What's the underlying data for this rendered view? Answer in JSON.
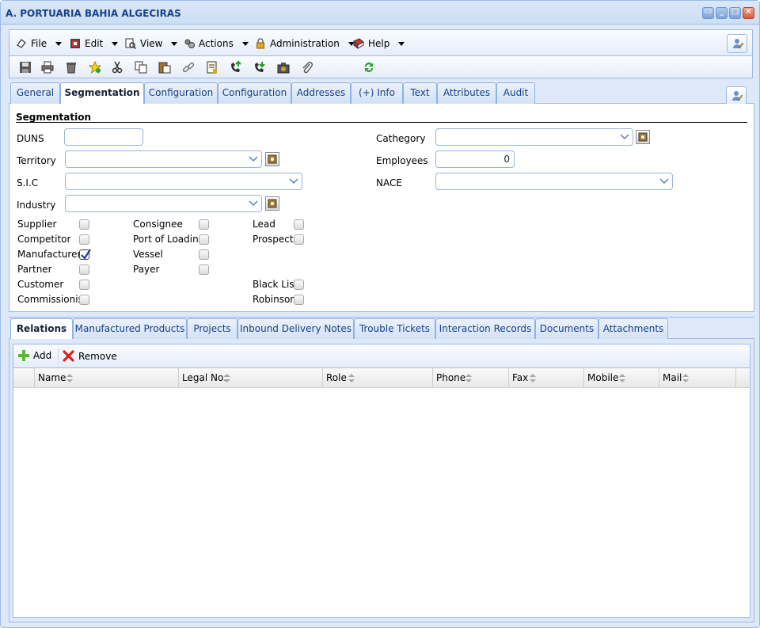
{
  "window": {
    "title": "A. PORTUARIA BAHIA ALGECIRAS",
    "controls": {
      "restore": "▭",
      "minimize": "_",
      "maximize": "□",
      "close": "×"
    }
  },
  "menubar": {
    "items": [
      {
        "label": "File",
        "icon": "file-icon"
      },
      {
        "label": "Edit",
        "icon": "edit-icon"
      },
      {
        "label": "View",
        "icon": "view-icon"
      },
      {
        "label": "Actions",
        "icon": "actions-icon"
      },
      {
        "label": "Administration",
        "icon": "lock-icon"
      },
      {
        "label": "Help",
        "icon": "help-icon"
      }
    ]
  },
  "toolbar": {
    "icons": [
      "save-icon",
      "print-icon",
      "delete-icon",
      "favorite-icon",
      "cut-icon",
      "copy-icon",
      "paste-icon",
      "link-icon",
      "report-icon",
      "call-out-icon",
      "call-in-icon",
      "camera-icon",
      "attach-icon",
      "refresh-icon"
    ]
  },
  "tabs": [
    "General",
    "Segmentation",
    "Configuration",
    "Configuration",
    "Addresses",
    "(+) Info",
    "Text",
    "Attributes",
    "Audit"
  ],
  "active_tab": "Segmentation",
  "form": {
    "section_title": "Segmentation",
    "duns": {
      "label": "DUNS",
      "value": ""
    },
    "territory": {
      "label": "Territory",
      "value": ""
    },
    "sic": {
      "label": "S.I.C",
      "value": ""
    },
    "industry": {
      "label": "Industry",
      "value": ""
    },
    "cathegory": {
      "label": "Cathegory",
      "value": ""
    },
    "employees": {
      "label": "Employees",
      "value": "0"
    },
    "nace": {
      "label": "NACE",
      "value": ""
    },
    "checkboxes": {
      "supplier": {
        "label": "Supplier",
        "checked": false
      },
      "competitor": {
        "label": "Competitor",
        "checked": false
      },
      "manufacturer": {
        "label": "Manufacturer",
        "checked": true
      },
      "partner": {
        "label": "Partner",
        "checked": false
      },
      "customer": {
        "label": "Customer",
        "checked": false
      },
      "commissionist": {
        "label": "Commissionist",
        "checked": false
      },
      "consignee": {
        "label": "Consignee",
        "checked": false
      },
      "port_of_loading": {
        "label": "Port of Loading",
        "checked": false
      },
      "vessel": {
        "label": "Vessel",
        "checked": false
      },
      "payer": {
        "label": "Payer",
        "checked": false
      },
      "lead": {
        "label": "Lead",
        "checked": false
      },
      "prospect": {
        "label": "Prospect",
        "checked": false
      },
      "black_list": {
        "label": "Black List",
        "checked": false
      },
      "robinson": {
        "label": "Robinson",
        "checked": false
      }
    }
  },
  "bottom_tabs": [
    "Relations",
    "Manufactured Products",
    "Projects",
    "Inbound Delivery Notes",
    "Trouble Tickets",
    "Interaction Records",
    "Documents",
    "Attachments"
  ],
  "active_bottom_tab": "Relations",
  "grid": {
    "add_label": "Add",
    "remove_label": "Remove",
    "columns": [
      "Name",
      "Legal No:",
      "Role",
      "Phone",
      "Fax",
      "Mobile",
      "Mail"
    ],
    "rows": []
  }
}
